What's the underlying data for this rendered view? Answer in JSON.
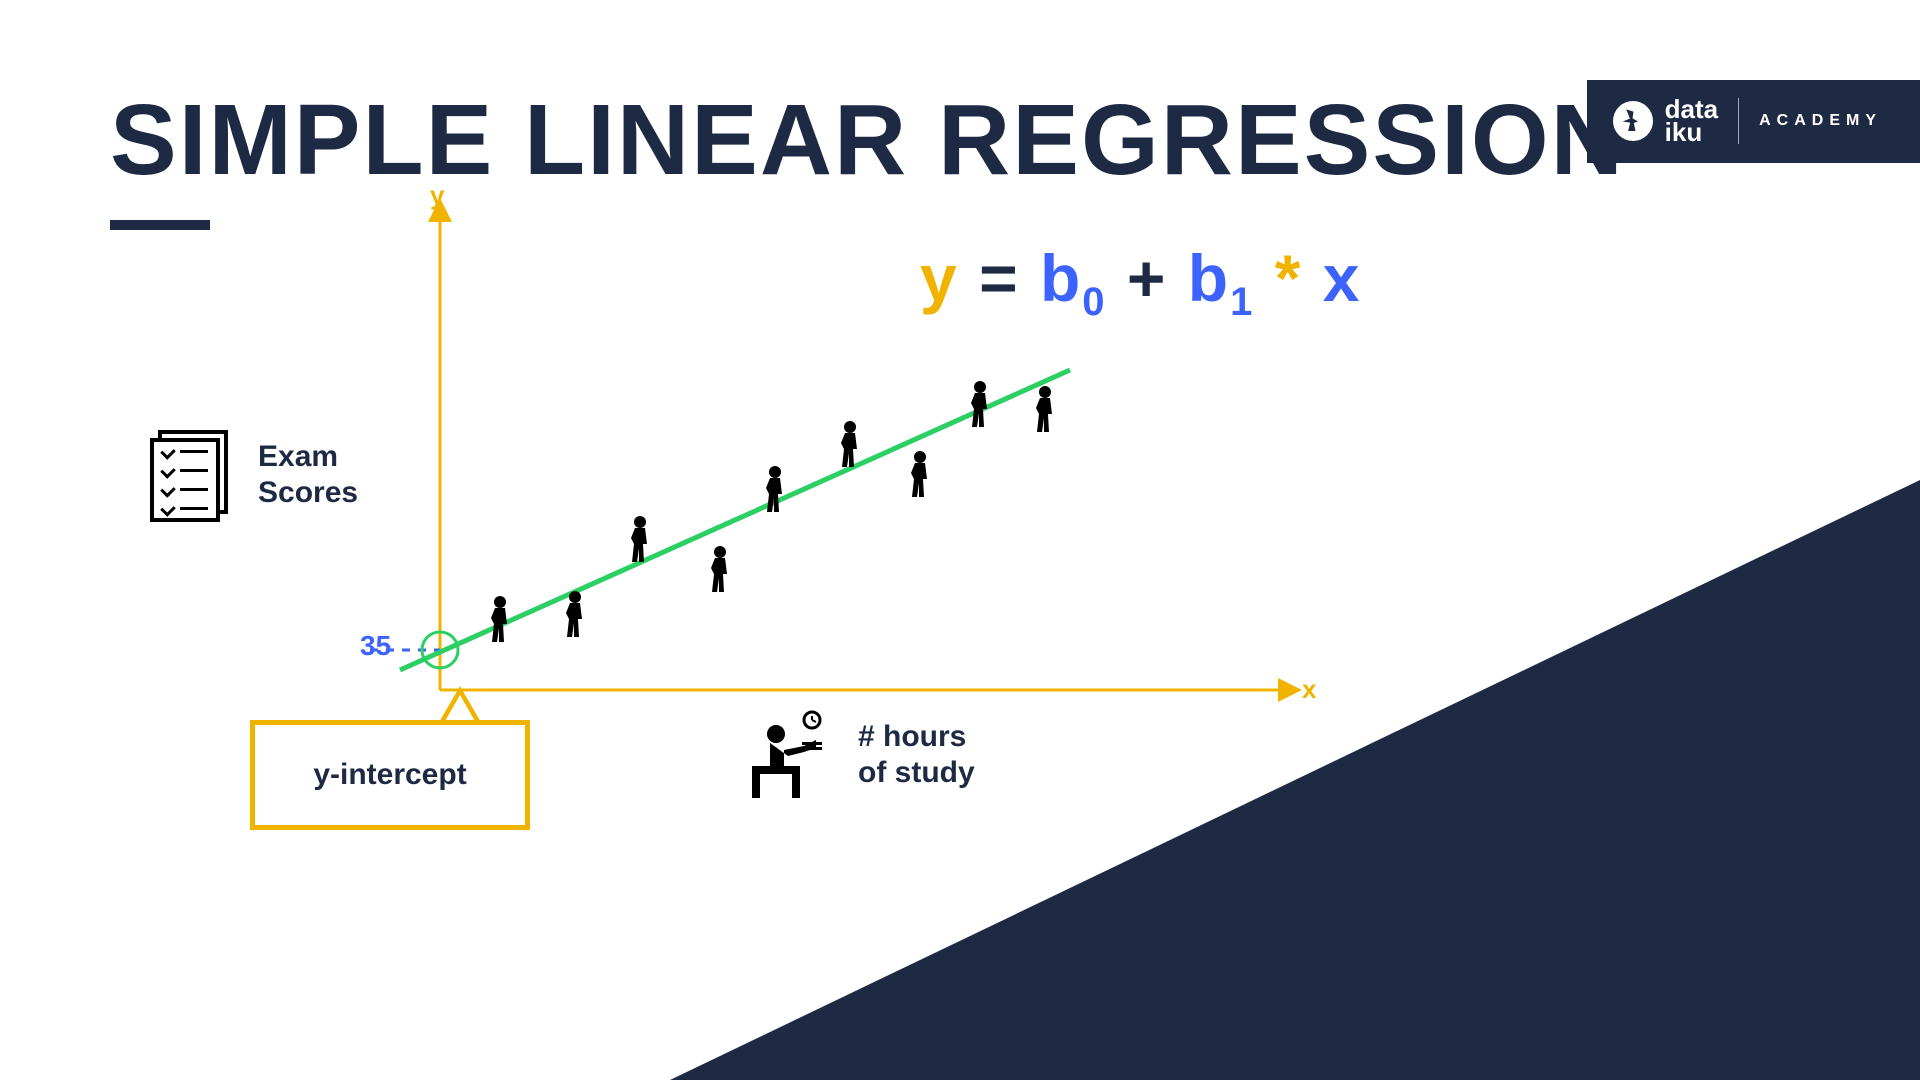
{
  "header": {
    "title": "SIMPLE LINEAR REGRESSION"
  },
  "brand": {
    "word1": "data",
    "word2": "iku",
    "academy": "ACADEMY"
  },
  "equation": {
    "y": "y",
    "eq": "=",
    "b": "b",
    "sub0": "0",
    "plus": "+",
    "sub1": "1",
    "star": "*",
    "x": "x"
  },
  "yaxis": {
    "label1": "Exam",
    "label2": "Scores",
    "letter": "y"
  },
  "xaxis": {
    "label1": "# hours",
    "label2": "of study",
    "letter": "x"
  },
  "intercept": {
    "value": "35",
    "label": "y-intercept"
  },
  "chart_data": {
    "type": "scatter",
    "title": "Simple Linear Regression",
    "xlabel": "# hours of study",
    "ylabel": "Exam Scores",
    "intercept_b0": 35,
    "regression_line": {
      "x": [
        0,
        10
      ],
      "y": [
        35,
        95
      ]
    },
    "points": [
      {
        "x": 1.0,
        "y": 41
      },
      {
        "x": 2.2,
        "y": 42
      },
      {
        "x": 3.2,
        "y": 55
      },
      {
        "x": 4.5,
        "y": 50
      },
      {
        "x": 5.4,
        "y": 68
      },
      {
        "x": 6.6,
        "y": 77
      },
      {
        "x": 7.7,
        "y": 73
      },
      {
        "x": 8.7,
        "y": 88
      },
      {
        "x": 9.6,
        "y": 87
      }
    ],
    "xlim": [
      0,
      10
    ],
    "ylim": [
      0,
      100
    ]
  }
}
